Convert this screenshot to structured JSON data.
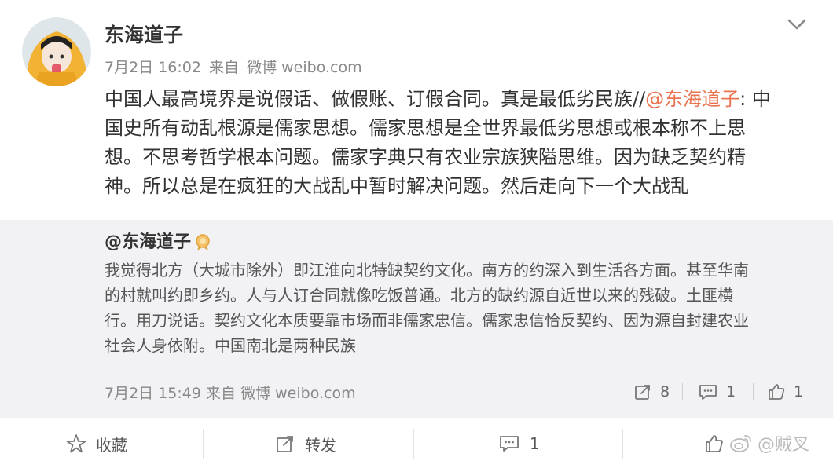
{
  "post": {
    "username": "东海道子",
    "date": "7月2日 16:02",
    "from_label": "来自",
    "source": "微博 weibo.com",
    "text_lines": [
      "中国人最高境界是说假话、做假账、订假合同。真是最低劣民族//",
      "国史所有动乱根源是儒家思想。儒家思想是全世界最低劣思想或根本称不上思",
      "想。不思考哲学根本问题。儒家字典只有农业宗族狭隘思维。因为缺乏契约精",
      "神。所以总是在疯狂的大战乱中暂时解决问题。然后走向下一个大战乱"
    ],
    "mention": "@东海道子",
    "after_mention": ": 中"
  },
  "repost": {
    "username": "@东海道子",
    "text_lines": [
      "我觉得北方（大城市除外）即江淮向北特缺契约文化。南方的约深入到生活各方面。甚至华南",
      "的村就叫约即乡约。人与人订合同就像吃饭普通。北方的缺约源自近世以来的残破。土匪横",
      "行。用刀说话。契约文化本质要靠市场而非儒家忠信。儒家忠信恰反契约、因为源自封建农业",
      "社会人身依附。中国南北是两种民族"
    ],
    "date": "7月2日 15:49",
    "from_label": "来自",
    "source": "微博 weibo.com",
    "repost_count": "8",
    "comment_count": "1",
    "like_count": "1"
  },
  "actions": {
    "favorite_label": "收藏",
    "forward_label": "转发",
    "comment_count": "1"
  },
  "watermark": "@贼叉",
  "colors": {
    "mention": "#eb7350",
    "repost_bg": "#f2f2f5",
    "meta_text": "#888888"
  },
  "icons": {
    "header": [
      "avatar",
      "chevron-down-icon"
    ],
    "repost_stats": [
      "repost-icon",
      "comment-icon",
      "like-icon"
    ],
    "footer": [
      "star-icon",
      "forward-icon",
      "comment-icon",
      "like-icon",
      "weibo-logo-icon"
    ]
  }
}
